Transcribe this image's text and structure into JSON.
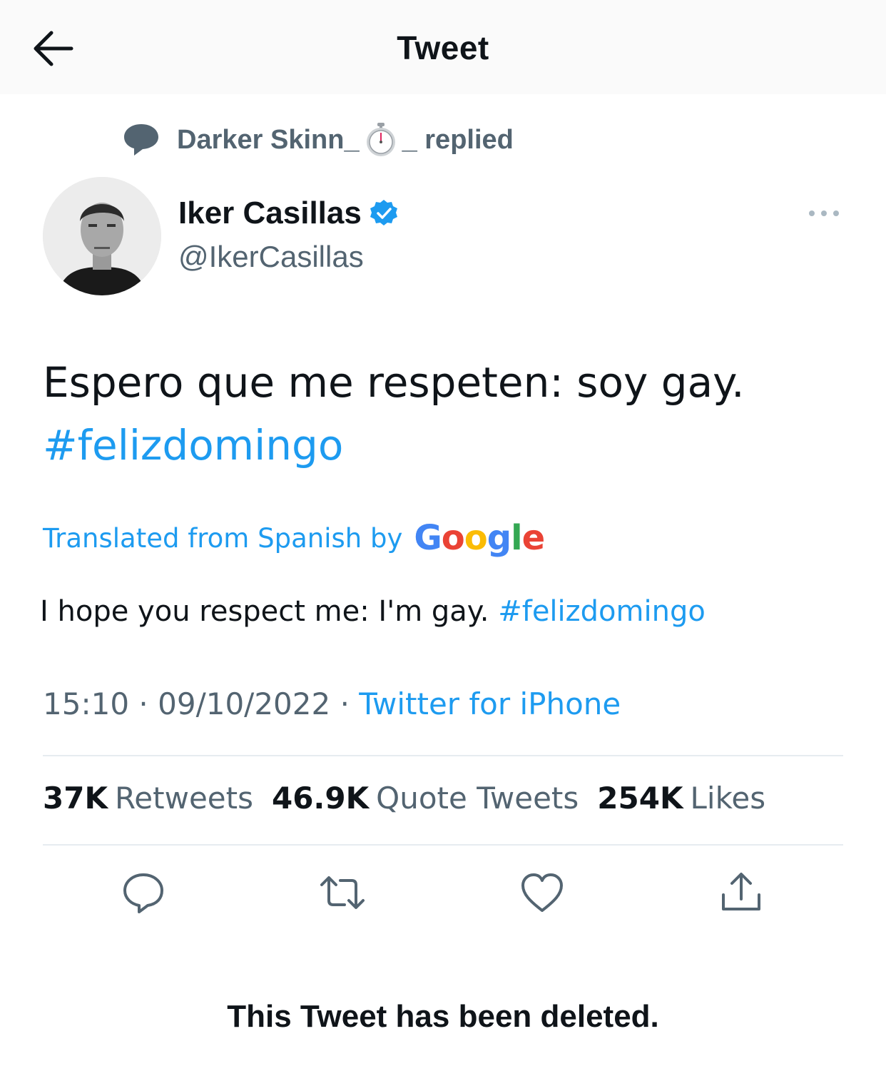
{
  "header": {
    "title": "Tweet"
  },
  "reply_context": {
    "prefix": "Darker Skinn_",
    "suffix": "_ replied",
    "icons": [
      "chat-bubble-icon",
      "stopwatch-icon"
    ]
  },
  "author": {
    "name": "Iker Casillas",
    "handle": "@IkerCasillas",
    "verified": true
  },
  "tweet": {
    "text": "Espero que me respeten: soy gay.",
    "hashtag": "#felizdomingo"
  },
  "translation": {
    "label": "Translated from Spanish by",
    "provider_letters": [
      "G",
      "o",
      "o",
      "g",
      "l",
      "e"
    ],
    "text": "I hope you respect me: I'm gay.",
    "hashtag": "#felizdomingo"
  },
  "meta": {
    "time": "15:10",
    "separator": "·",
    "date": "09/10/2022",
    "source": "Twitter for iPhone"
  },
  "stats": [
    {
      "count": "37K",
      "label": "Retweets"
    },
    {
      "count": "46.9K",
      "label": "Quote Tweets"
    },
    {
      "count": "254K",
      "label": "Likes"
    }
  ],
  "actions": [
    "reply-icon",
    "retweet-icon",
    "like-icon",
    "share-icon"
  ],
  "colors": {
    "accent": "#1d9bf0",
    "muted": "#536471",
    "text": "#0f1419"
  },
  "notice": "This Tweet has been deleted."
}
